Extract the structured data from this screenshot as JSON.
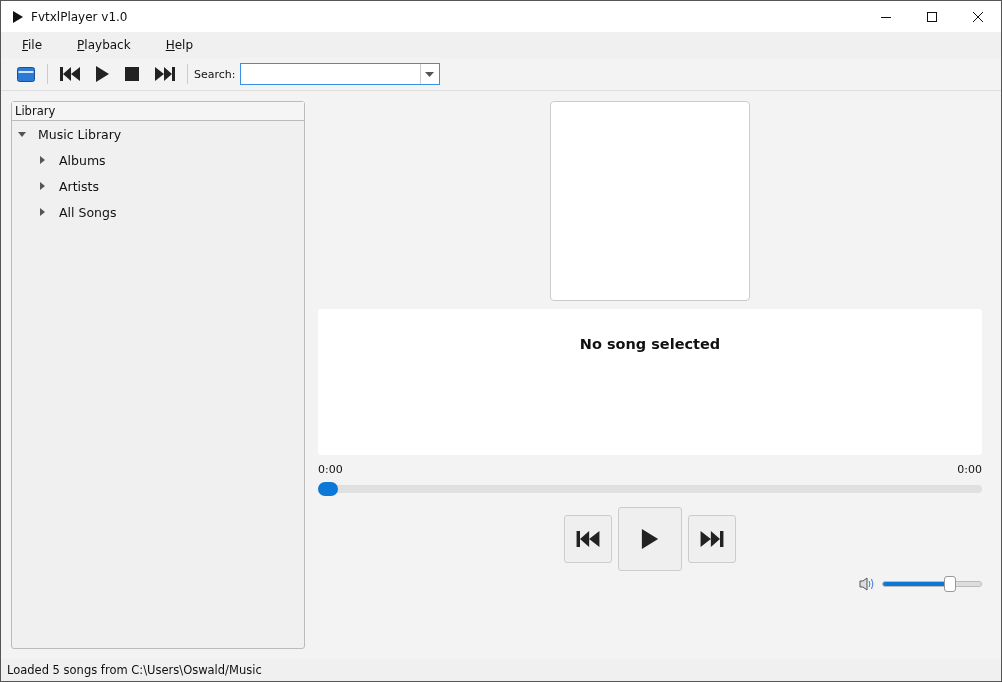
{
  "window": {
    "title": "FvtxlPlayer v1.0"
  },
  "menu": [
    "File",
    "Playback",
    "Help"
  ],
  "toolbar": {
    "search_label": "Search:"
  },
  "library": {
    "header": "Library",
    "tree": [
      {
        "label": "Music Library",
        "expanded": true,
        "children": [
          {
            "label": "Albums",
            "expanded": false
          },
          {
            "label": "Artists",
            "expanded": false
          },
          {
            "label": "All Songs",
            "expanded": false
          }
        ]
      }
    ]
  },
  "now_playing": {
    "title": "No song selected",
    "elapsed": "0:00",
    "total": "0:00",
    "progress": {
      "level": 0
    },
    "volume": {
      "level": 0.68
    }
  },
  "status_bar": "Loaded 5 songs from C:\\Users\\Oswald/Music"
}
